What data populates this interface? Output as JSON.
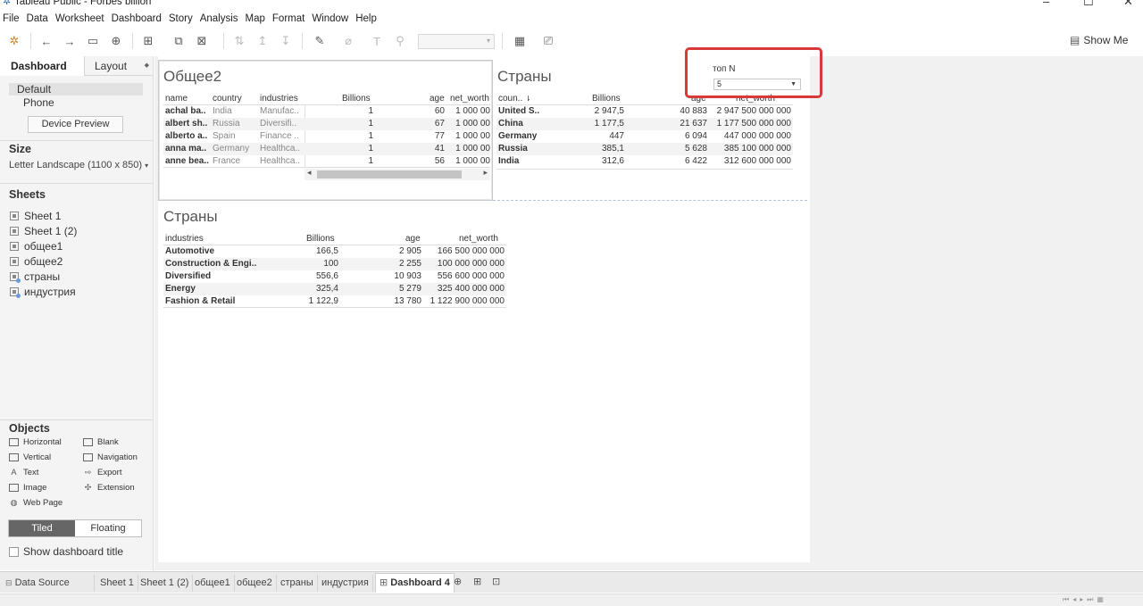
{
  "window": {
    "title": "Tableau Public - Forbes billion",
    "controls": [
      "–",
      "☐",
      "✕"
    ]
  },
  "menu": [
    "File",
    "Data",
    "Worksheet",
    "Dashboard",
    "Story",
    "Analysis",
    "Map",
    "Format",
    "Window",
    "Help"
  ],
  "toolbar": {
    "show_me": "Show Me"
  },
  "left_panel": {
    "tabs": {
      "dashboard": "Dashboard",
      "layout": "Layout"
    },
    "devices": {
      "default": "Default",
      "phone": "Phone",
      "preview_button": "Device Preview"
    },
    "size": {
      "heading": "Size",
      "value": "Letter Landscape (1100 x 850)"
    },
    "sheets": {
      "heading": "Sheets",
      "items": [
        "Sheet 1",
        "Sheet 1 (2)",
        "общее1",
        "общее2",
        "страны",
        "индустрия"
      ]
    },
    "objects": {
      "heading": "Objects",
      "items": [
        "Horizontal",
        "Blank",
        "Vertical",
        "Navigation",
        "Text",
        "Export",
        "Image",
        "Extension",
        "Web Page"
      ]
    },
    "layout_mode": {
      "tiled": "Tiled",
      "floating": "Floating"
    },
    "show_title": "Show dashboard title"
  },
  "dashboard": {
    "sheet_a": {
      "title": "Общее2",
      "headers": [
        "name",
        "country",
        "industries",
        "Billions",
        "age",
        "net_worth"
      ],
      "rows": [
        [
          "achal ba..",
          "India",
          "Manufac..",
          "1",
          "60",
          "1 000 00"
        ],
        [
          "albert sh..",
          "Russia",
          "Diversifi..",
          "1",
          "67",
          "1 000 00"
        ],
        [
          "alberto a..",
          "Spain",
          "Finance ..",
          "1",
          "77",
          "1 000 00"
        ],
        [
          "anna ma..",
          "Germany",
          "Healthca..",
          "1",
          "41",
          "1 000 00"
        ],
        [
          "anne bea..",
          "France",
          "Healthca..",
          "1",
          "56",
          "1 000 00"
        ]
      ]
    },
    "sheet_b": {
      "title": "Страны",
      "headers": [
        "coun..",
        "Billions",
        "age",
        "net_worth"
      ],
      "rows": [
        [
          "United S..",
          "2 947,5",
          "40 883",
          "2 947 500 000 000"
        ],
        [
          "China",
          "1 177,5",
          "21 637",
          "1 177 500 000 000"
        ],
        [
          "Germany",
          "447",
          "6 094",
          "447 000 000 000"
        ],
        [
          "Russia",
          "385,1",
          "5 628",
          "385 100 000 000"
        ],
        [
          "India",
          "312,6",
          "6 422",
          "312 600 000 000"
        ]
      ]
    },
    "sheet_c": {
      "title": "Страны",
      "headers": [
        "industries",
        "Billions",
        "age",
        "net_worth"
      ],
      "rows": [
        [
          "Automotive",
          "166,5",
          "2 905",
          "166 500 000 000"
        ],
        [
          "Construction & Engi..",
          "100",
          "2 255",
          "100 000 000 000"
        ],
        [
          "Diversified",
          "556,6",
          "10 903",
          "556 600 000 000"
        ],
        [
          "Energy",
          "325,4",
          "5 279",
          "325 400 000 000"
        ],
        [
          "Fashion & Retail",
          "1 122,9",
          "13 780",
          "1 122 900 000 000"
        ]
      ]
    },
    "parameter": {
      "label": "топ N",
      "value": "5"
    }
  },
  "bottom_tabs": {
    "data_source": "Data Source",
    "sheets": [
      "Sheet 1",
      "Sheet 1 (2)",
      "общее1",
      "общее2",
      "страны",
      "индустрия"
    ],
    "active": "Dashboard 4"
  },
  "colors": {
    "highlight": "#d83a3a",
    "accent": "#2a6aa8"
  }
}
